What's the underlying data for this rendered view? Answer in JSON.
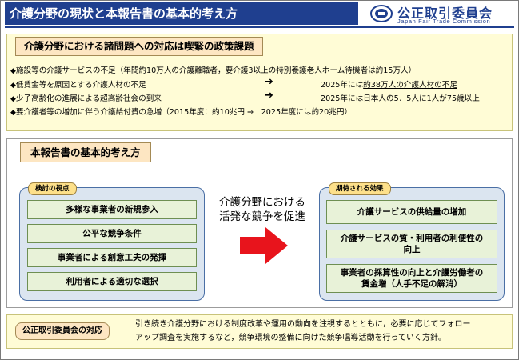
{
  "header": {
    "title": "介護分野の現状と本報告書の基本的考え方",
    "org_name": "公正取引委員会",
    "org_name_en": "Japan Fair Trade Commission"
  },
  "issues": {
    "heading": "介護分野における諸問題への対応は喫緊の政策課題",
    "bullets": [
      {
        "marker": "◆",
        "text": "施設等の介護サービスの不足（年間約10万人の介護離職者，要介護3以上の特別養護老人ホーム待機者は約15万人）"
      },
      {
        "marker": "◆",
        "text": "低賃金等を原因とする介護人材の不足",
        "arrow": "➔",
        "result_prefix": "2025年には",
        "result_emph": "約38万人の介護人材の不足"
      },
      {
        "marker": "◆",
        "text": "少子高齢化の進展による超高齢社会の到来",
        "arrow": "➔",
        "result_prefix": "2025年には日本人の",
        "result_emph": "5．5人に1人が75歳以上"
      },
      {
        "marker": "◆",
        "text": "要介護者等の増加に伴う介護給付費の急増（2015年度：約10兆円 ⇒　2025年度には約20兆円）"
      }
    ]
  },
  "basic": {
    "heading": "本報告書の基本的考え方",
    "left_panel": {
      "tag": "検討の視点",
      "items": [
        "多様な事業者の新規参入",
        "公平な競争条件",
        "事業者による創意工夫の発揮",
        "利用者による適切な選択"
      ]
    },
    "middle": {
      "line1": "介護分野における",
      "line2": "活発な競争を促進"
    },
    "right_panel": {
      "tag": "期待される効果",
      "items": [
        {
          "line1": "介護サービスの供給量の増加",
          "line2": ""
        },
        {
          "line1": "介護サービスの質・利用者の利便性の",
          "line2": "向上"
        },
        {
          "line1": "事業者の採算性の向上と介護労働者の",
          "line2": "賃金増（人手不足の解消）"
        }
      ]
    }
  },
  "response": {
    "tag": "公正取引委員会の対応",
    "line1": "引き続き介護分野における制度改革や運用の動向を注視するとともに，必要に応じてフォロー",
    "line2": "アップ調査を実施するなど，競争環境の整備に向けた競争唱導活動を行っていく方針。"
  },
  "colors": {
    "header_bg": "#1f3f8f",
    "arrow_red": "#e8141c",
    "panel_bg": "#dbe5f0",
    "item_bg": "#e8f2d8",
    "cream_bg": "#fffcd6",
    "heading_bg": "#fde6c2",
    "tag_bg": "#fde08a"
  }
}
